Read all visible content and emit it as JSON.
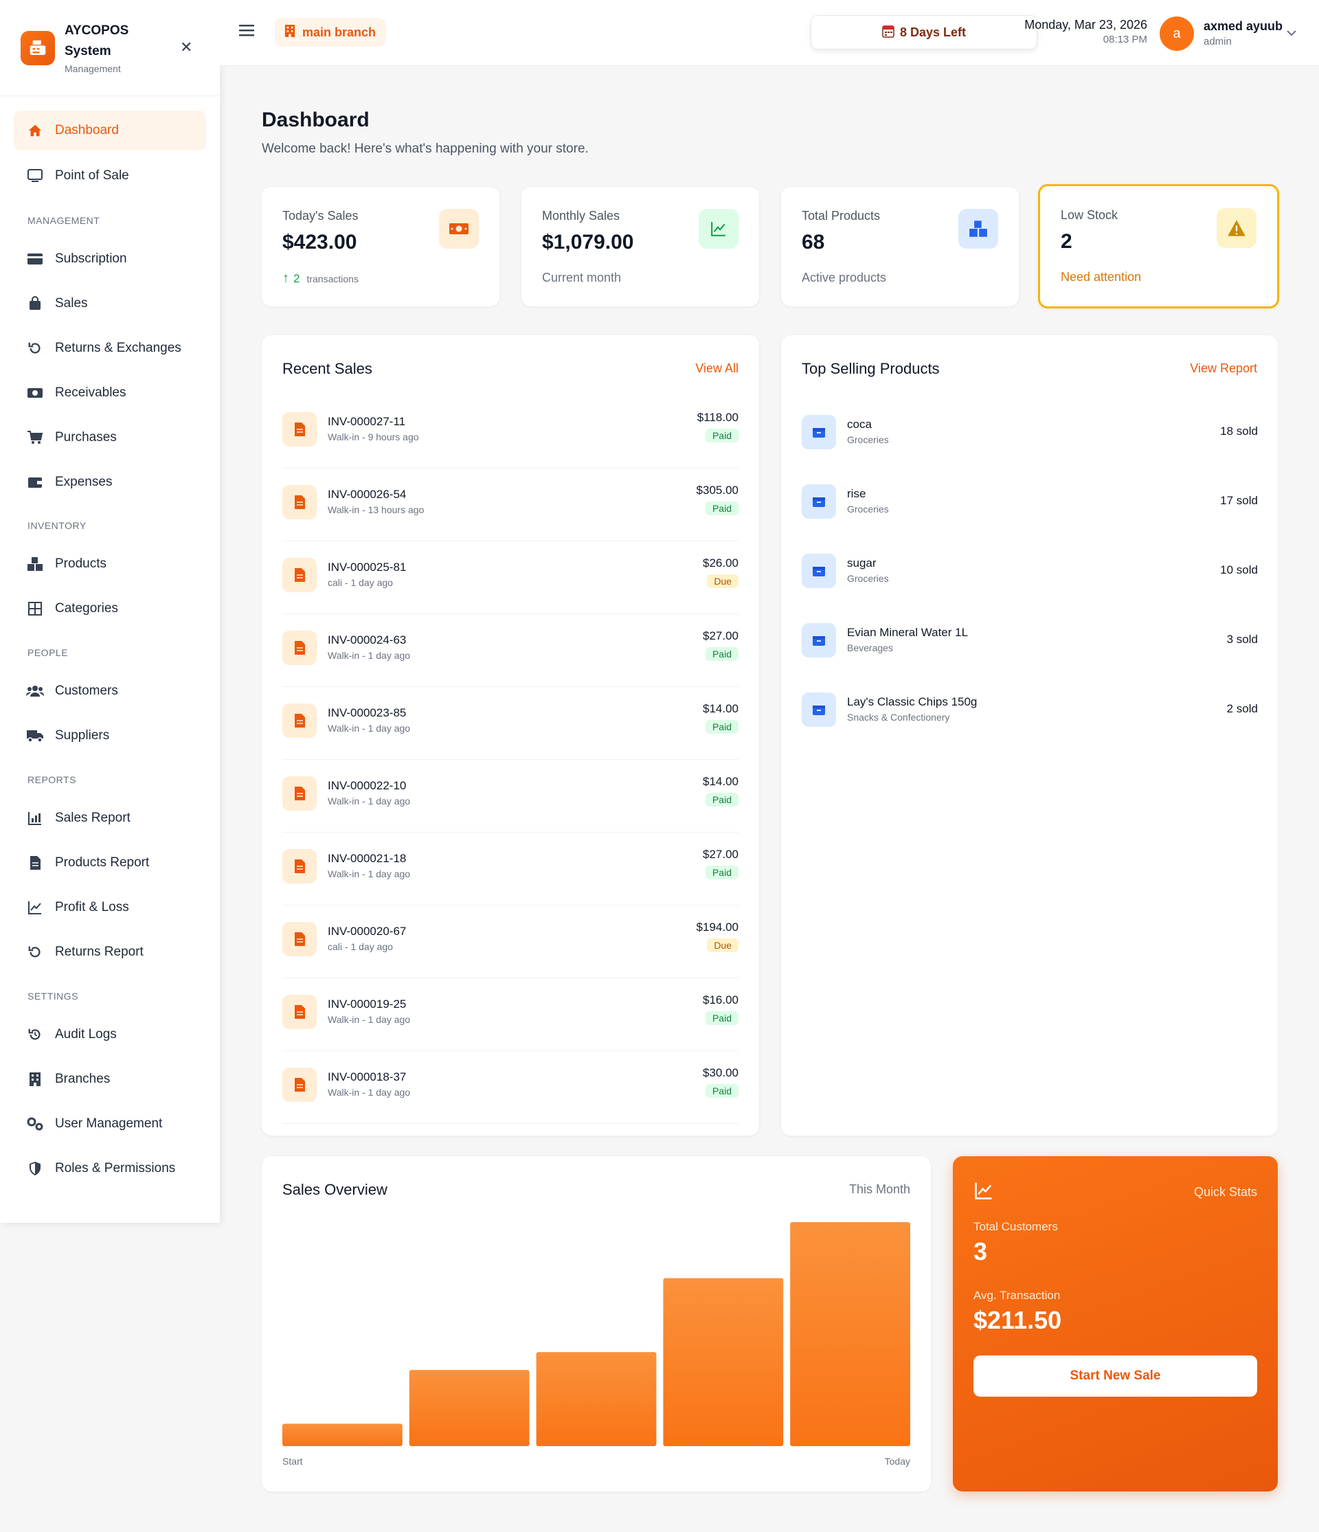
{
  "brand": {
    "title": "AYCOPOS System",
    "subtitle": "Management"
  },
  "nav": {
    "dashboard": "Dashboard",
    "pos": "Point of Sale",
    "sec_management": "MANAGEMENT",
    "subscription": "Subscription",
    "sales": "Sales",
    "returns": "Returns & Exchanges",
    "receivables": "Receivables",
    "purchases": "Purchases",
    "expenses": "Expenses",
    "sec_inventory": "INVENTORY",
    "products": "Products",
    "categories": "Categories",
    "sec_people": "PEOPLE",
    "customers": "Customers",
    "suppliers": "Suppliers",
    "sec_reports": "REPORTS",
    "sales_report": "Sales Report",
    "products_report": "Products Report",
    "profit_loss": "Profit & Loss",
    "returns_report": "Returns Report",
    "sec_settings": "SETTINGS",
    "audit_logs": "Audit Logs",
    "branches": "Branches",
    "user_mgmt": "User Management",
    "roles": "Roles & Permissions"
  },
  "topbar": {
    "branch": "main branch",
    "days_left": "8 Days Left",
    "date": "Monday, Mar 23, 2026",
    "time": "08:13 PM",
    "avatar_initial": "a",
    "user_name": "axmed ayuub",
    "user_role": "admin"
  },
  "page": {
    "title": "Dashboard",
    "subtitle": "Welcome back! Here's what's happening with your store."
  },
  "stats": {
    "today": {
      "label": "Today's Sales",
      "value": "$423.00",
      "count": "2",
      "foot": "transactions"
    },
    "monthly": {
      "label": "Monthly Sales",
      "value": "$1,079.00",
      "foot": "Current month"
    },
    "products": {
      "label": "Total Products",
      "value": "68",
      "foot": "Active products"
    },
    "low": {
      "label": "Low Stock",
      "value": "2",
      "foot": "Need attention"
    }
  },
  "recent": {
    "title": "Recent Sales",
    "link": "View All",
    "rows": [
      {
        "inv": "INV-000027-11",
        "meta": "Walk-in - 9 hours ago",
        "amount": "$118.00",
        "status": "Paid"
      },
      {
        "inv": "INV-000026-54",
        "meta": "Walk-in - 13 hours ago",
        "amount": "$305.00",
        "status": "Paid"
      },
      {
        "inv": "INV-000025-81",
        "meta": "cali - 1 day ago",
        "amount": "$26.00",
        "status": "Due"
      },
      {
        "inv": "INV-000024-63",
        "meta": "Walk-in - 1 day ago",
        "amount": "$27.00",
        "status": "Paid"
      },
      {
        "inv": "INV-000023-85",
        "meta": "Walk-in - 1 day ago",
        "amount": "$14.00",
        "status": "Paid"
      },
      {
        "inv": "INV-000022-10",
        "meta": "Walk-in - 1 day ago",
        "amount": "$14.00",
        "status": "Paid"
      },
      {
        "inv": "INV-000021-18",
        "meta": "Walk-in - 1 day ago",
        "amount": "$27.00",
        "status": "Paid"
      },
      {
        "inv": "INV-000020-67",
        "meta": "cali - 1 day ago",
        "amount": "$194.00",
        "status": "Due"
      },
      {
        "inv": "INV-000019-25",
        "meta": "Walk-in - 1 day ago",
        "amount": "$16.00",
        "status": "Paid"
      },
      {
        "inv": "INV-000018-37",
        "meta": "Walk-in - 1 day ago",
        "amount": "$30.00",
        "status": "Paid"
      }
    ]
  },
  "top": {
    "title": "Top Selling Products",
    "link": "View Report",
    "rows": [
      {
        "name": "coca",
        "category": "Groceries",
        "sold": "18 sold"
      },
      {
        "name": "rise",
        "category": "Groceries",
        "sold": "17 sold"
      },
      {
        "name": "sugar",
        "category": "Groceries",
        "sold": "10 sold"
      },
      {
        "name": "Evian Mineral Water 1L",
        "category": "Beverages",
        "sold": "3 sold"
      },
      {
        "name": "Lay's Classic Chips 150g",
        "category": "Snacks & Confectionery",
        "sold": "2 sold"
      }
    ]
  },
  "overview": {
    "title": "Sales Overview",
    "period": "This Month",
    "x_start": "Start",
    "x_end": "Today"
  },
  "chart_data": {
    "type": "bar",
    "title": "Sales Overview",
    "categories": [
      "",
      "",
      "",
      "",
      ""
    ],
    "values": [
      0.1,
      0.34,
      0.42,
      0.75,
      1.0
    ],
    "ylim": [
      0,
      1
    ],
    "grid": false,
    "bar_color": "#f97316"
  },
  "quick": {
    "label": "Quick Stats",
    "customers_label": "Total Customers",
    "customers_value": "3",
    "avg_label": "Avg. Transaction",
    "avg_value": "$211.50",
    "button": "Start New Sale"
  },
  "colors": {
    "accent": "#ea580c",
    "accent_light": "#fff4ea",
    "paid": "#15803d",
    "due": "#b45309",
    "warning": "#f5b50a"
  }
}
